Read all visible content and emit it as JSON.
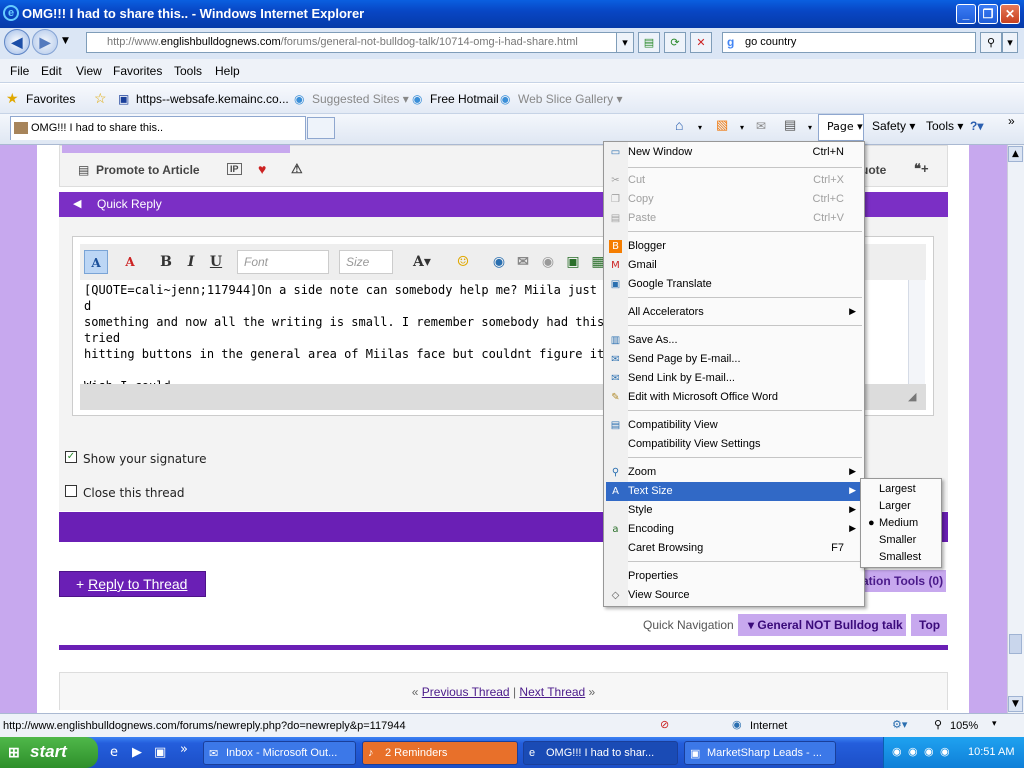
{
  "window": {
    "title": "OMG!!! I had to share this.. - Windows Internet Explorer"
  },
  "nav": {
    "url_prefix": "http://www.",
    "url_host": "englishbulldognews.com",
    "url_path": "/forums/general-not-bulldog-talk/10714-omg-i-had-share.html",
    "search_value": "go country"
  },
  "menubar": [
    "File",
    "Edit",
    "View",
    "Favorites",
    "Tools",
    "Help"
  ],
  "favorites": {
    "label": "Favorites",
    "items": [
      "https--websafe.kemainc.co...",
      "Suggested Sites ▾",
      "Free Hotmail",
      "Web Slice Gallery ▾"
    ]
  },
  "tab": {
    "title": "OMG!!! I had to share this.."
  },
  "commandbar": {
    "page": "Page ▾",
    "safety": "Safety ▾",
    "tools": "Tools ▾"
  },
  "forum": {
    "promote": "Promote to Article",
    "quote": "uote",
    "quick_reply": "Quick Reply",
    "font_placeholder": "Font",
    "size_placeholder": "Size",
    "editor_text": "[QUOTE=cali~jenn;117944]On a side note can somebody help me? Miila just pu                                       d\nsomething and now all the writing is small. I remember somebody had this happ                                       tried\nhitting buttons in the general area of Miilas face but couldnt figure it out. lol[/\n\nWish I could",
    "show_signature": "Show your signature",
    "close_thread": "Close this thread",
    "reply_button": "Reply to Thread",
    "thread_tools": "ation Tools (0)",
    "quick_nav_label": "Quick Navigation",
    "quick_nav_value": "General NOT Bulldog talk",
    "top": "Top",
    "prev_thread": "Previous Thread",
    "next_thread": "Next Thread"
  },
  "page_menu": {
    "new_window": "New Window",
    "new_window_sc": "Ctrl+N",
    "cut": "Cut",
    "cut_sc": "Ctrl+X",
    "copy": "Copy",
    "copy_sc": "Ctrl+C",
    "paste": "Paste",
    "paste_sc": "Ctrl+V",
    "blogger": "Blogger",
    "gmail": "Gmail",
    "translate": "Google Translate",
    "accelerators": "All Accelerators",
    "save_as": "Save As...",
    "send_page": "Send Page by E-mail...",
    "send_link": "Send Link by E-mail...",
    "edit_word": "Edit with Microsoft Office Word",
    "compat_view": "Compatibility View",
    "compat_settings": "Compatibility View Settings",
    "zoom": "Zoom",
    "text_size": "Text Size",
    "style": "Style",
    "encoding": "Encoding",
    "caret": "Caret Browsing",
    "caret_sc": "F7",
    "properties": "Properties",
    "view_source": "View Source"
  },
  "text_size_menu": {
    "largest": "Largest",
    "larger": "Larger",
    "medium": "Medium",
    "smaller": "Smaller",
    "smallest": "Smallest"
  },
  "statusbar": {
    "url": "http://www.englishbulldognews.com/forums/newreply.php?do=newreply&p=117944",
    "zone": "Internet",
    "zoom": "105%"
  },
  "taskbar": {
    "start": "start",
    "items": [
      "Inbox - Microsoft Out...",
      "2 Reminders",
      "OMG!!! I had to shar...",
      "MarketSharp Leads - ..."
    ],
    "clock": "10:51 AM"
  }
}
